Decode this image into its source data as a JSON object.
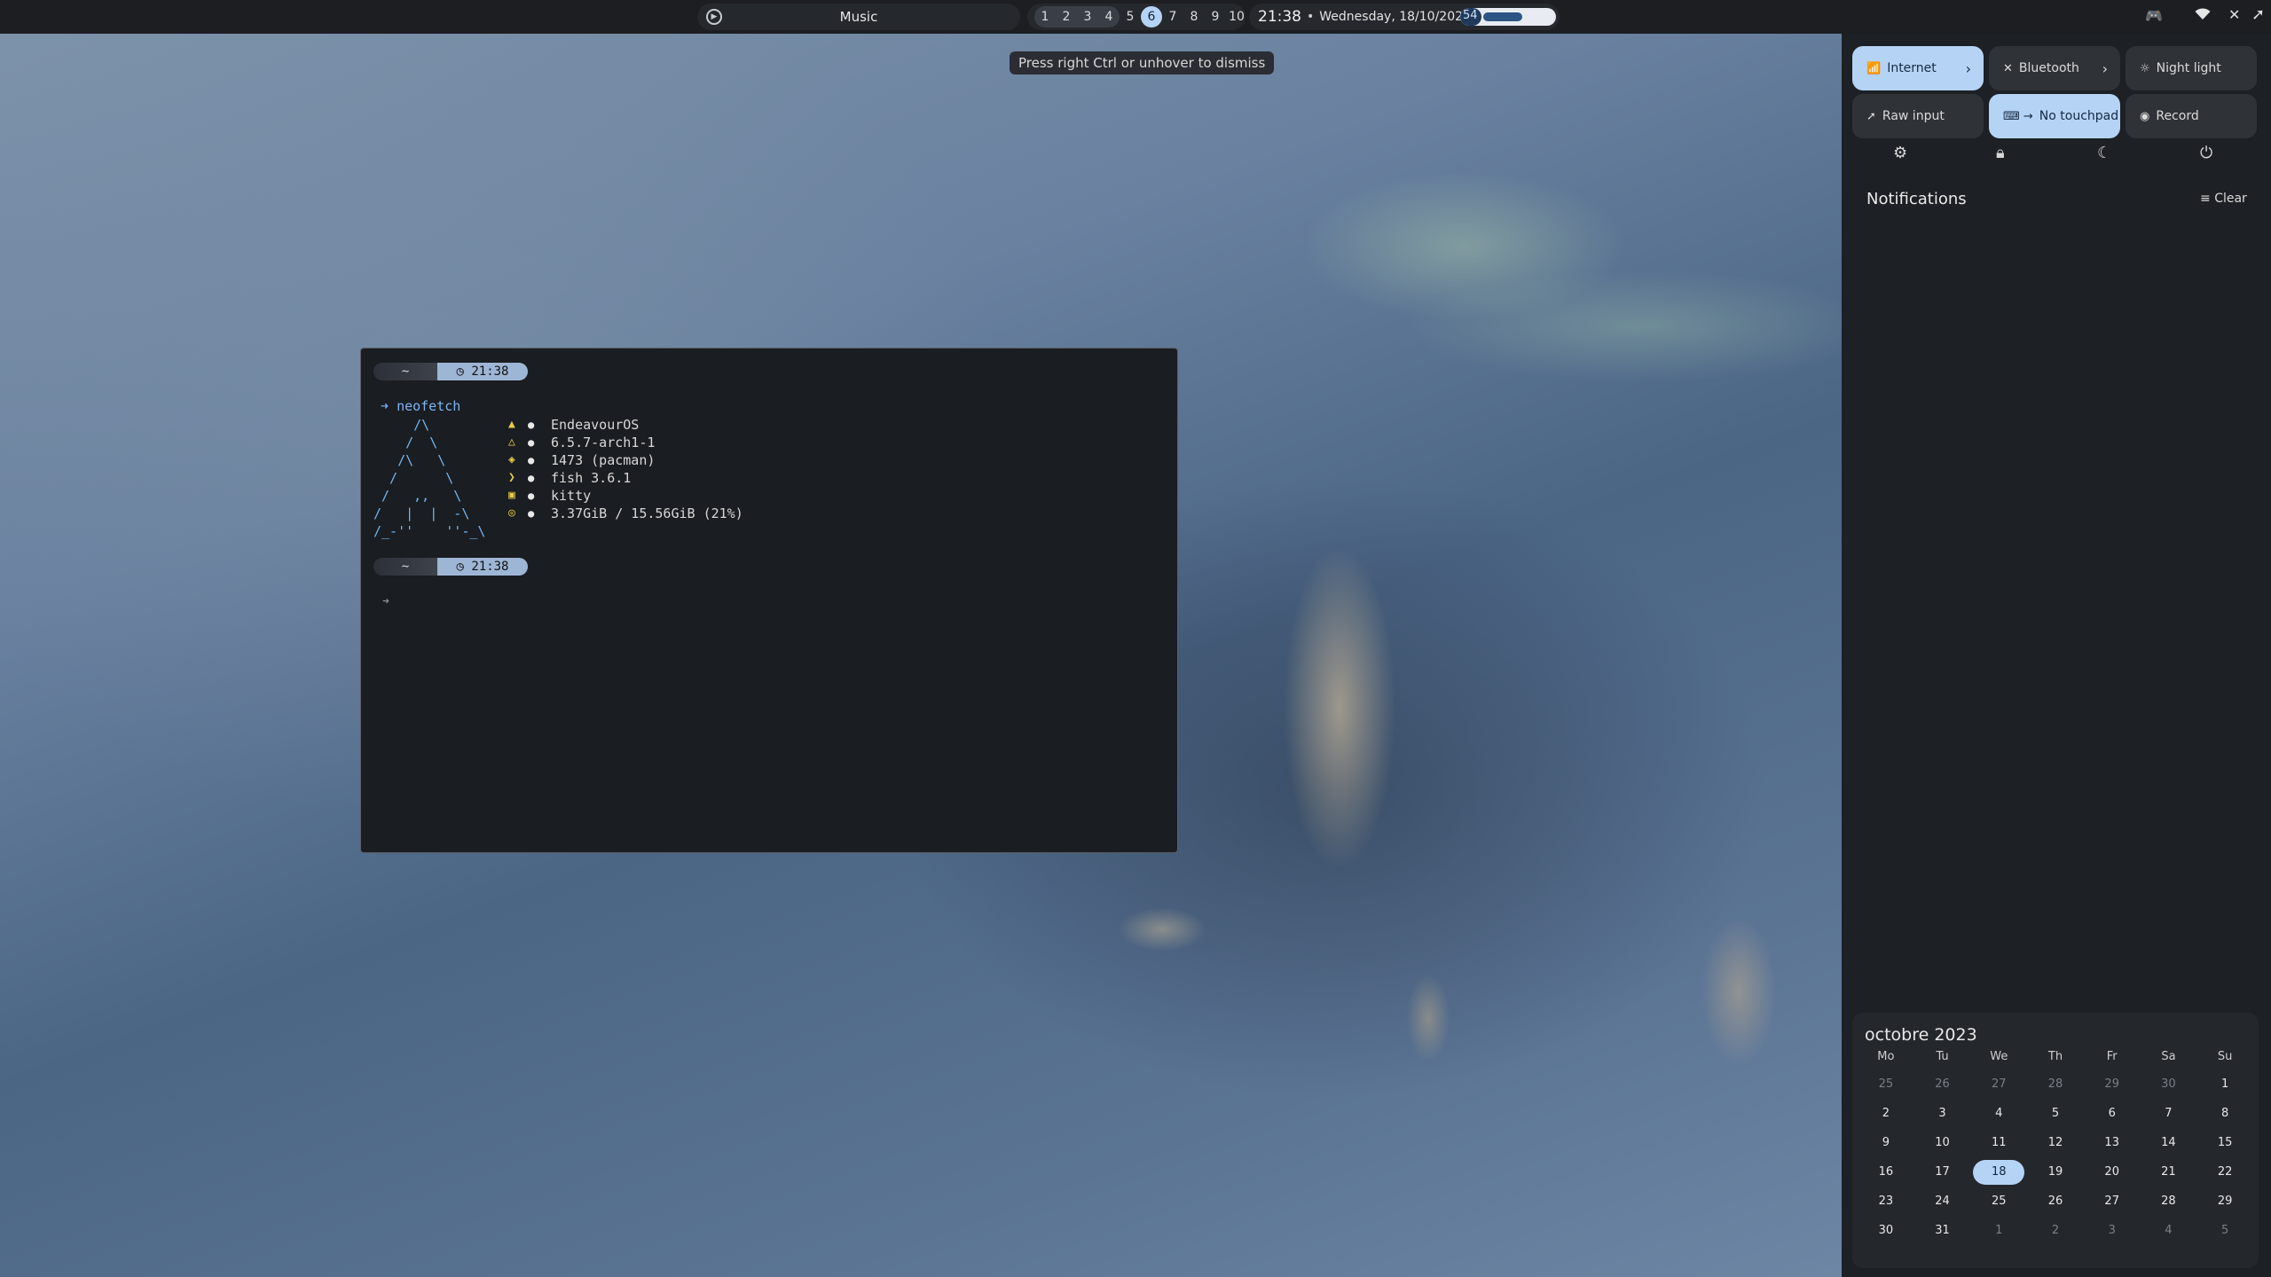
{
  "topbar": {
    "media": {
      "icon": "play-circle-icon",
      "title": "Music"
    },
    "workspaces": {
      "occupied": [
        "1",
        "2",
        "3",
        "4"
      ],
      "rest": [
        "5",
        "6",
        "7",
        "8",
        "9",
        "10"
      ],
      "active": "6"
    },
    "clock": {
      "time": "21:38",
      "separator": "•",
      "date": "Wednesday, 18/10/2023"
    },
    "battery": {
      "percent": "54",
      "level": 54
    },
    "tray": [
      "discord-icon",
      "wifi-icon",
      "bluetooth-off-icon"
    ]
  },
  "hint": "Press right Ctrl or unhover to dismiss",
  "terminal": {
    "prompt_dir": "~",
    "prompt_time": "21:38",
    "command": "neofetch",
    "logo": "     /\\\n    /  \\\n   /\\   \\\n  /      \\\n /   ,,   \\\n/   |  |  -\\\n/_-''    ''-_\\",
    "info": [
      {
        "icon": "os-icon",
        "text": "EndeavourOS"
      },
      {
        "icon": "kernel-icon",
        "text": "6.5.7-arch1-1"
      },
      {
        "icon": "packages-icon",
        "text": "1473 (pacman)"
      },
      {
        "icon": "shell-icon",
        "text": "fish 3.6.1"
      },
      {
        "icon": "terminal-icon",
        "text": "kitty"
      },
      {
        "icon": "memory-icon",
        "text": "3.37GiB / 15.56GiB (21%)"
      }
    ],
    "cursor": "➜"
  },
  "quick_settings": {
    "internet": "Internet",
    "bluetooth": "Bluetooth",
    "night_light": "Night light",
    "raw_input": "Raw input",
    "no_touchpad": "No touchpad",
    "record": "Record"
  },
  "notifications": {
    "title": "Notifications",
    "clear": "Clear"
  },
  "calendar": {
    "title": "octobre 2023",
    "weekdays": [
      "Mo",
      "Tu",
      "We",
      "Th",
      "Fr",
      "Sa",
      "Su"
    ],
    "weeks": [
      [
        "25",
        "26",
        "27",
        "28",
        "29",
        "30",
        "1"
      ],
      [
        "2",
        "3",
        "4",
        "5",
        "6",
        "7",
        "8"
      ],
      [
        "9",
        "10",
        "11",
        "12",
        "13",
        "14",
        "15"
      ],
      [
        "16",
        "17",
        "18",
        "19",
        "20",
        "21",
        "22"
      ],
      [
        "23",
        "24",
        "25",
        "26",
        "27",
        "28",
        "29"
      ],
      [
        "30",
        "31",
        "1",
        "2",
        "3",
        "4",
        "5"
      ]
    ],
    "today": "18"
  },
  "colors": {
    "accent": "#b5d3f5",
    "panel": "#1d2024",
    "terminal_bg": "#1a1d21"
  }
}
